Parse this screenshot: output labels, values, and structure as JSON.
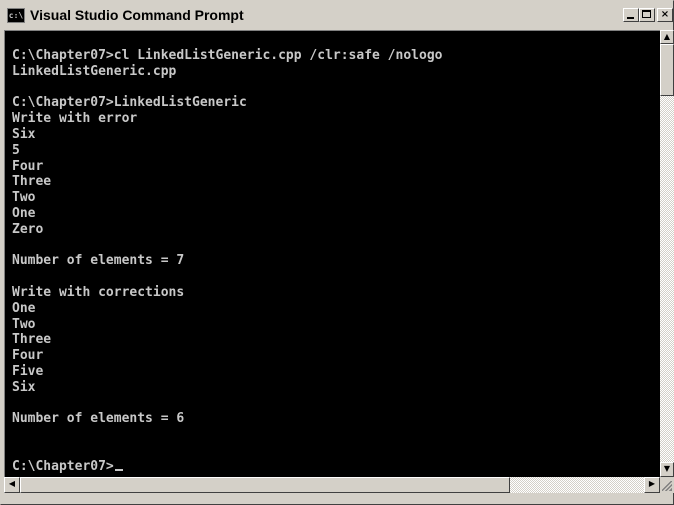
{
  "window": {
    "title": "Visual Studio Command Prompt",
    "icon": "cmd-icon",
    "icon_text": "c:\\",
    "minimize_label": "_",
    "maximize_label": "□",
    "close_label": "×"
  },
  "console": {
    "lines": [
      "C:\\Chapter07>cl LinkedListGeneric.cpp /clr:safe /nologo",
      "LinkedListGeneric.cpp",
      "",
      "C:\\Chapter07>LinkedListGeneric",
      "Write with error",
      "Six",
      "5",
      "Four",
      "Three",
      "Two",
      "One",
      "Zero",
      "",
      "Number of elements = 7",
      "",
      "Write with corrections",
      "One",
      "Two",
      "Three",
      "Four",
      "Five",
      "Six",
      "",
      "Number of elements = 6",
      "",
      "",
      "C:\\Chapter07>"
    ],
    "text_color": "#c8c8c8",
    "background_color": "#000000"
  },
  "scrollbars": {
    "up_arrow": "▲",
    "down_arrow": "▼",
    "left_arrow": "◀",
    "right_arrow": "▶"
  }
}
